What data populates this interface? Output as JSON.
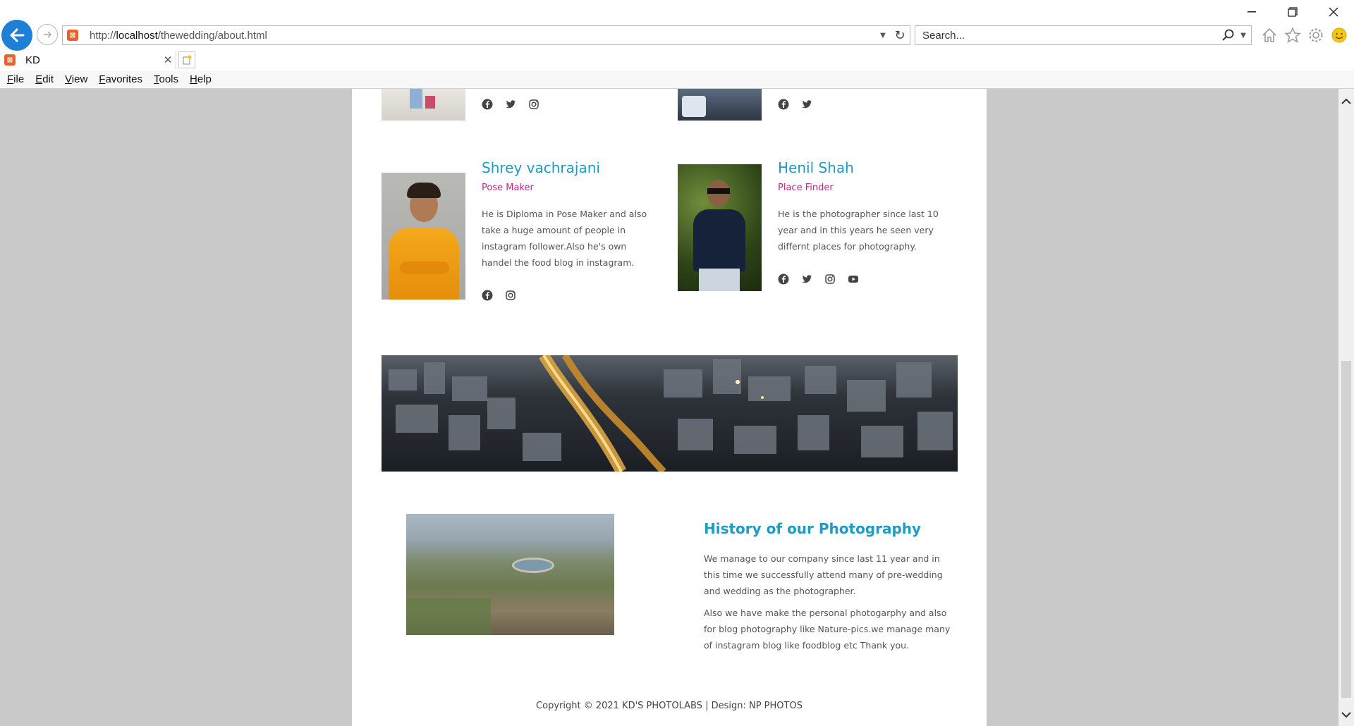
{
  "browser": {
    "url_prefix": "http://",
    "url_host": "localhost",
    "url_path": "/thewedding/about.html",
    "search_placeholder": "Search...",
    "tab_title": "KD",
    "menu": [
      "File",
      "Edit",
      "View",
      "Favorites",
      "Tools",
      "Help"
    ],
    "accent": "#1e7fd6"
  },
  "team": [
    {
      "name": "Shrey vachrajani",
      "role": "Pose Maker",
      "bio": "He is Diploma in Pose Maker and also take a huge amount of people in instagram follower.Also he's own handel the food blog in instagram.",
      "socials": [
        "facebook-icon",
        "instagram-icon"
      ]
    },
    {
      "name": "Henil Shah",
      "role": "Place Finder",
      "bio": "He is the photographer since last 10 year and in this years he seen very differnt places for photography.",
      "socials": [
        "facebook-icon",
        "twitter-icon",
        "instagram-icon",
        "youtube-icon"
      ]
    }
  ],
  "history": {
    "title": "History of our Photography",
    "paragraph1": "We manage to our company since last 11 year and in this time we successfully attend many of pre-wedding and wedding as the photographer.",
    "paragraph2": "Also we have make the personal photogarphy and also for blog photography like Nature-pics.we manage many of instagram blog like foodblog etc Thank you."
  },
  "footer": {
    "copyright": "Copyright © 2021 KD'S PHOTOLABS | Design: NP PHOTOS"
  },
  "colors": {
    "name": "#1e9bc7",
    "role": "#c7218d",
    "text": "#555555",
    "background": "#c9c9c9"
  }
}
